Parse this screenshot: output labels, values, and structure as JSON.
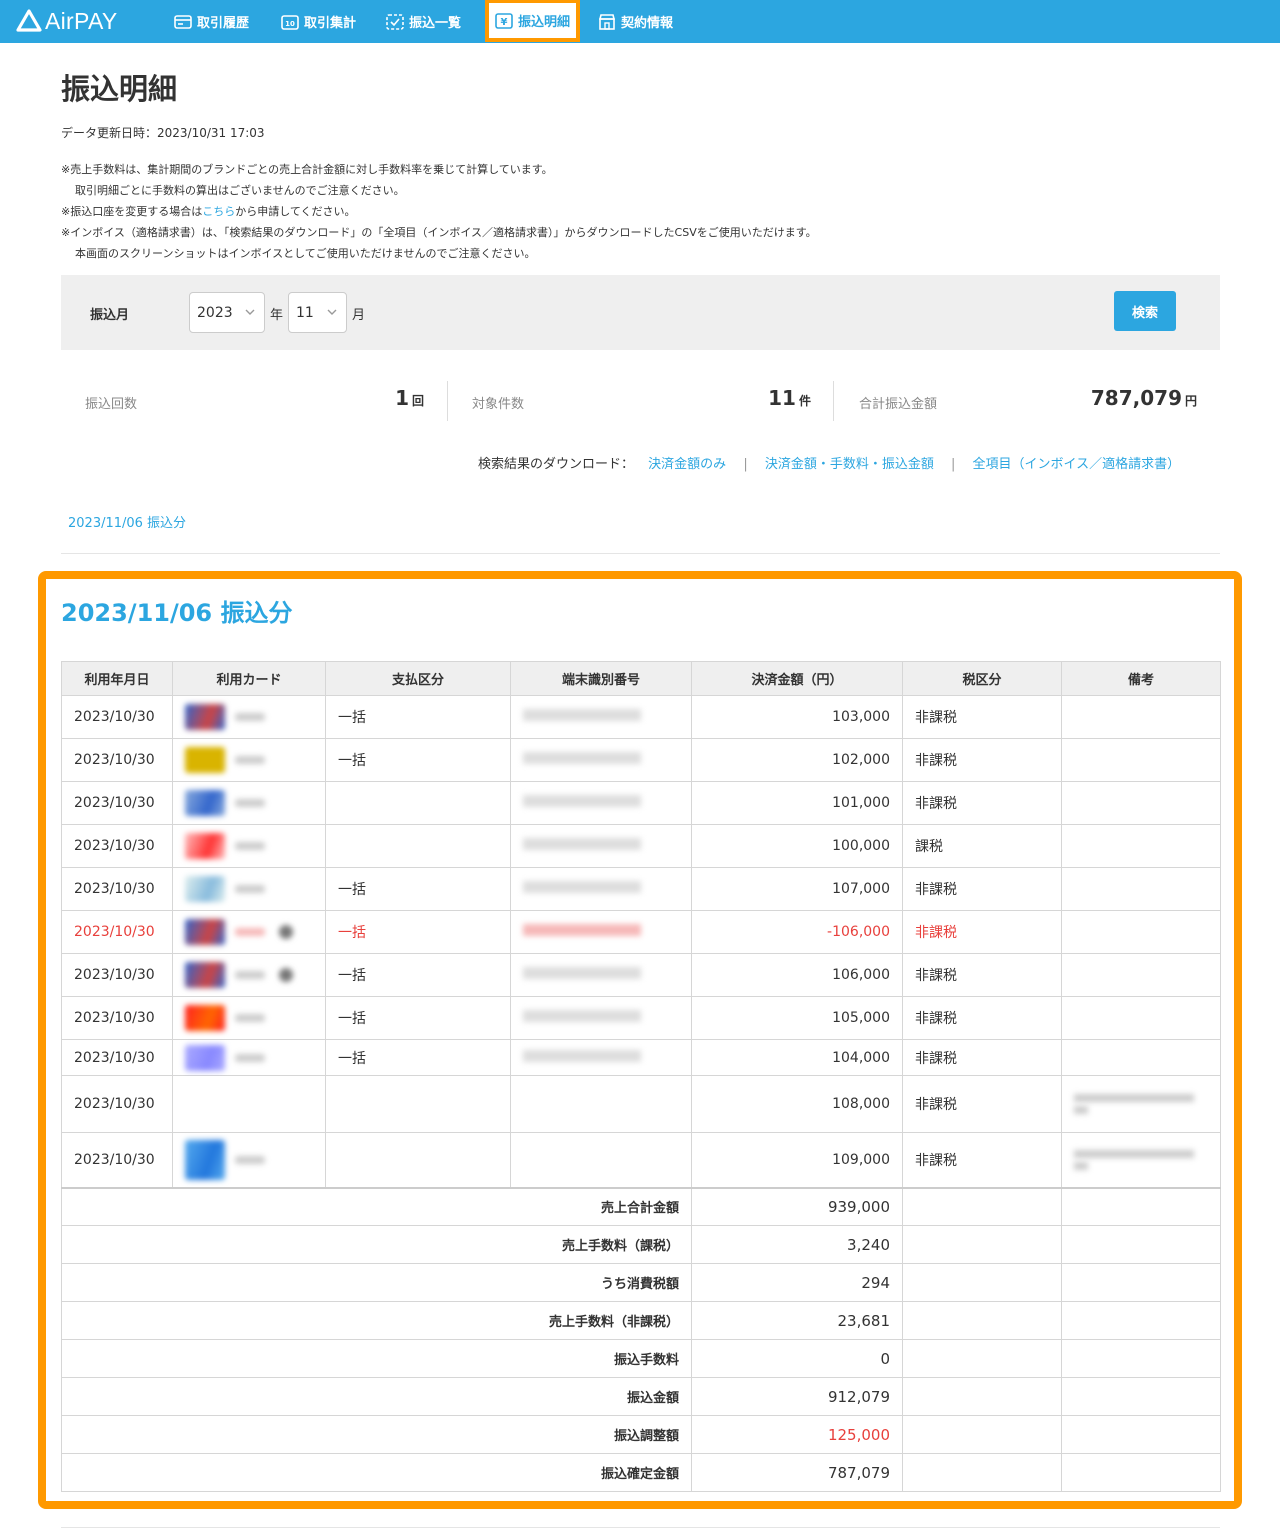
{
  "app": {
    "logo": "AirPAY"
  },
  "nav": [
    {
      "label": "取引履歴",
      "icon": "receipt-icon"
    },
    {
      "label": "取引集計",
      "icon": "calendar-icon"
    },
    {
      "label": "振込一覧",
      "icon": "list-icon"
    },
    {
      "label": "振込明細",
      "icon": "yen-icon",
      "active": true
    },
    {
      "label": "契約情報",
      "icon": "store-icon"
    }
  ],
  "page": {
    "title": "振込明細",
    "updated": "データ更新日時：2023/10/31 17:03",
    "notes": {
      "line1": "※売上手数料は、集計期間のブランドごとの売上合計金額に対し手数料率を乗じて計算しています。",
      "line2": "取引明細ごとに手数料の算出はございませんのでご注意ください。",
      "line3_pre": "※振込口座を変更する場合は",
      "line3_link": "こちら",
      "line3_post": "から申請してください。",
      "line4": "※インボイス（適格請求書）は、「検索結果のダウンロード」の「全項目（インボイス／適格請求書）」からダウンロードしたCSVをご使用いただけます。",
      "line5": "本画面のスクリーンショットはインボイスとしてご使用いただけませんのでご注意ください。"
    }
  },
  "search": {
    "label": "振込月",
    "year": "2023",
    "year_unit": "年",
    "month": "11",
    "month_unit": "月",
    "button": "検索"
  },
  "summary": {
    "count_label": "振込回数",
    "count_value": "1",
    "count_unit": "回",
    "items_label": "対象件数",
    "items_value": "11",
    "items_unit": "件",
    "total_label": "合計振込金額",
    "total_value": "787,079",
    "total_unit": "円"
  },
  "downloads": {
    "label": "検索結果のダウンロード：",
    "opt1": "決済金額のみ",
    "opt2": "決済金額・手数料・振込金額",
    "opt3": "全項目（インボイス／適格請求書）",
    "sep": "|"
  },
  "anchor": "2023/11/06 振込分",
  "section": {
    "title": "2023/11/06 振込分",
    "headers": [
      "利用年月日",
      "利用カード",
      "支払区分",
      "端末識別番号",
      "決済金額（円）",
      "税区分",
      "備考"
    ],
    "rows": [
      {
        "date": "2023/10/30",
        "pay": "一括",
        "amount": "103,000",
        "tax": "非課税",
        "card_color": "#c44",
        "card_color2": "#36c"
      },
      {
        "date": "2023/10/30",
        "pay": "一括",
        "amount": "102,000",
        "tax": "非課税",
        "card_color": "#d9b400",
        "card_color2": "#d9b400"
      },
      {
        "date": "2023/10/30",
        "pay": "",
        "amount": "101,000",
        "tax": "非課税",
        "card_color": "#36c",
        "card_color2": "#8ad"
      },
      {
        "date": "2023/10/30",
        "pay": "",
        "amount": "100,000",
        "tax": "課税",
        "card_color": "#f33",
        "card_color2": "#fbb"
      },
      {
        "date": "2023/10/30",
        "pay": "一括",
        "amount": "107,000",
        "tax": "非課税",
        "card_color": "#8bd",
        "card_color2": "#dee"
      },
      {
        "date": "2023/10/30",
        "pay": "一括",
        "amount": "-106,000",
        "tax": "非課税",
        "card_color": "#c44",
        "card_color2": "#36c",
        "negative": true
      },
      {
        "date": "2023/10/30",
        "pay": "一括",
        "amount": "106,000",
        "tax": "非課税",
        "card_color": "#c44",
        "card_color2": "#36c"
      },
      {
        "date": "2023/10/30",
        "pay": "一括",
        "amount": "105,000",
        "tax": "非課税",
        "card_color": "#f60",
        "card_color2": "#f22"
      },
      {
        "date": "2023/10/30",
        "pay": "一括",
        "amount": "104,000",
        "tax": "非課税",
        "card_color": "#88f",
        "card_color2": "#aaf"
      },
      {
        "date": "2023/10/30",
        "pay": "",
        "amount": "108,000",
        "tax": "非課税",
        "card_color": "#fff",
        "card_color2": "#fff",
        "memo": true
      },
      {
        "date": "2023/10/30",
        "pay": "",
        "amount": "109,000",
        "tax": "非課税",
        "card_color": "#27d",
        "card_color2": "#5ae",
        "memo": true
      }
    ],
    "totals": [
      {
        "label": "売上合計金額",
        "value": "939,000"
      },
      {
        "label": "売上手数料（課税）",
        "value": "3,240"
      },
      {
        "label": "うち消費税額",
        "value": "294"
      },
      {
        "label": "売上手数料（非課税）",
        "value": "23,681"
      },
      {
        "label": "振込手数料",
        "value": "0"
      },
      {
        "label": "振込金額",
        "value": "912,079"
      },
      {
        "label": "振込調整額",
        "value": "125,000",
        "red": true
      },
      {
        "label": "振込確定金額",
        "value": "787,079"
      }
    ]
  },
  "colors": {
    "brand": "#2ca6e0",
    "highlight": "#ff9900",
    "negative": "#e8403c"
  }
}
